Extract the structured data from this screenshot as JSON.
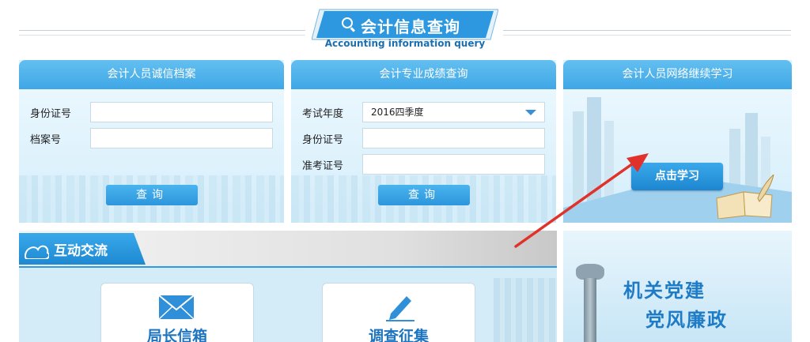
{
  "header": {
    "title": "会计信息查询",
    "subtitle": "Accounting information query",
    "icon": "search-icon"
  },
  "panels": {
    "integrity": {
      "title": "会计人员诚信档案",
      "fields": [
        {
          "label": "身份证号",
          "value": ""
        },
        {
          "label": "档案号",
          "value": ""
        }
      ],
      "button": "查询"
    },
    "scores": {
      "title": "会计专业成绩查询",
      "fields": [
        {
          "label": "考试年度",
          "value": "2016四季度"
        },
        {
          "label": "身份证号",
          "value": ""
        },
        {
          "label": "准考证号",
          "value": ""
        }
      ],
      "button": "查询"
    },
    "learning": {
      "title": "会计人员网络继续学习",
      "button": "点击学习"
    }
  },
  "interaction": {
    "tab": "互动交流",
    "cards": [
      {
        "label": "局长信箱",
        "icon": "envelope-icon"
      },
      {
        "label": "调查征集",
        "icon": "pencil-icon"
      }
    ]
  },
  "banner": {
    "line1": "机关党建",
    "line2": "党风廉政"
  },
  "colors": {
    "accent": "#3fa7e6",
    "button": "#2d96dc",
    "arrow": "#e0322a"
  }
}
